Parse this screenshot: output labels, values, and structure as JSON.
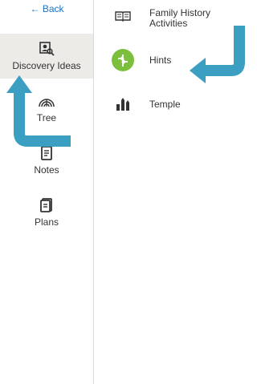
{
  "nav": {
    "back_label": "← Back",
    "items": [
      {
        "label": "Discovery Ideas",
        "icon": "discovery-ideas-icon",
        "active": true
      },
      {
        "label": "Tree",
        "icon": "tree-icon",
        "active": false
      },
      {
        "label": "Notes",
        "icon": "notes-icon",
        "active": false
      },
      {
        "label": "Plans",
        "icon": "plans-icon",
        "active": false
      }
    ]
  },
  "main": {
    "items": [
      {
        "label": "Family History Activities",
        "icon": "book-icon"
      },
      {
        "label": "Hints",
        "icon": "hints-icon"
      },
      {
        "label": "Temple",
        "icon": "temple-icon"
      }
    ]
  },
  "colors": {
    "accent": "#1d72c7",
    "active_bg": "#ecebe8",
    "hints_green": "#7cbf3f",
    "callout_arrow": "#3a9fc0"
  }
}
